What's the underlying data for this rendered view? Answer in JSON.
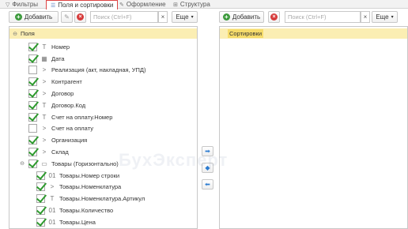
{
  "tabs": [
    {
      "label": "Фильтры",
      "icon": "filter-icon",
      "active": false
    },
    {
      "label": "Поля и сортировки",
      "icon": "fields-sort-icon",
      "active": true
    },
    {
      "label": "Оформление",
      "icon": "brush-icon",
      "active": false
    },
    {
      "label": "Структура",
      "icon": "structure-icon",
      "active": false
    }
  ],
  "left_toolbar": {
    "add_label": "Добавить",
    "search_placeholder": "Поиск (Ctrl+F)",
    "clear_label": "×",
    "more_label": "Еще"
  },
  "right_toolbar": {
    "add_label": "Добавить",
    "search_placeholder": "Поиск (Ctrl+F)",
    "clear_label": "×",
    "more_label": "Еще"
  },
  "fields": {
    "root_label": "Поля",
    "items": [
      {
        "label": "Номер",
        "checked": true,
        "icon": "T",
        "expand": ""
      },
      {
        "label": "Дата",
        "checked": true,
        "icon": "▦",
        "expand": ""
      },
      {
        "label": "Реализация (акт, накладная, УПД)",
        "checked": false,
        "icon": ">",
        "expand": ""
      },
      {
        "label": "Контрагент",
        "checked": true,
        "icon": ">",
        "expand": ""
      },
      {
        "label": "Договор",
        "checked": true,
        "icon": ">",
        "expand": ""
      },
      {
        "label": "Договор.Код",
        "checked": true,
        "icon": "T",
        "expand": ""
      },
      {
        "label": "Счет на оплату.Номер",
        "checked": true,
        "icon": "T",
        "expand": ""
      },
      {
        "label": "Счет на оплату",
        "checked": false,
        "icon": ">",
        "expand": ""
      },
      {
        "label": "Организация",
        "checked": true,
        "icon": ">",
        "expand": ""
      },
      {
        "label": "Склад",
        "checked": true,
        "icon": ">",
        "expand": ""
      },
      {
        "label": "Товары (Горизонтально)",
        "checked": true,
        "icon": "▭",
        "expand": "⊖"
      },
      {
        "label": "Товары.Номер строки",
        "checked": true,
        "icon": "01",
        "expand": ""
      },
      {
        "label": "Товары.Номенклатура",
        "checked": true,
        "icon": ">",
        "expand": ""
      },
      {
        "label": "Товары.Номенклатура.Артикул",
        "checked": true,
        "icon": "T",
        "expand": ""
      },
      {
        "label": "Товары.Количество",
        "checked": true,
        "icon": "01",
        "expand": ""
      },
      {
        "label": "Товары.Цена",
        "checked": true,
        "icon": "01",
        "expand": ""
      }
    ]
  },
  "sorting": {
    "root_label": "Сортировки"
  },
  "watermark": "БухЭксперт"
}
